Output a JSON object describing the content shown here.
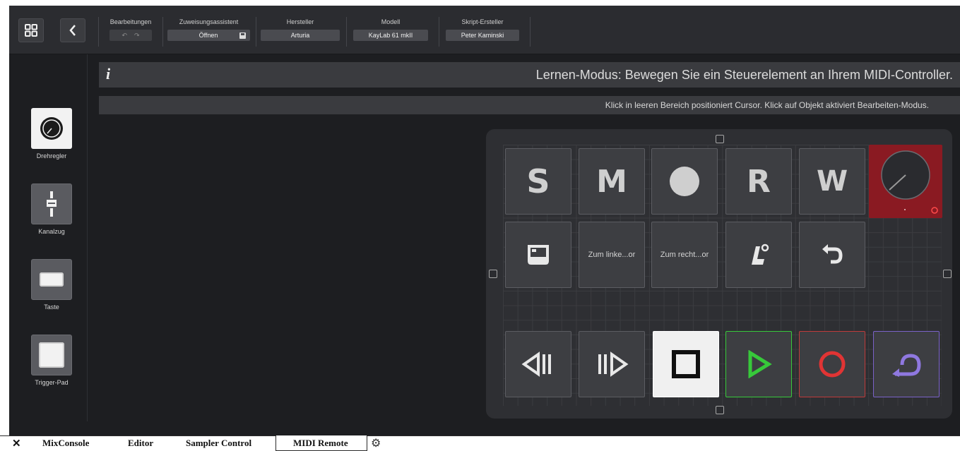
{
  "toolbar": {
    "layout_icon": "grid-icon",
    "back_icon": "chevron-left-icon",
    "edits": {
      "label": "Bearbeitungen",
      "undo_icon": "undo-icon",
      "redo_icon": "redo-icon"
    },
    "assignment": {
      "label": "Zuweisungsassistent",
      "button": "Öffnen",
      "icon": "save-icon"
    },
    "manufacturer": {
      "label": "Hersteller",
      "value": "Arturia"
    },
    "model": {
      "label": "Modell",
      "value": "KayLab 61 mkII"
    },
    "script_author": {
      "label": "Skript-Ersteller",
      "value": "Peter Kaminski"
    }
  },
  "palette": {
    "items": [
      {
        "label": "Drehregler",
        "icon": "knob-icon"
      },
      {
        "label": "Kanalzug",
        "icon": "fader-icon"
      },
      {
        "label": "Taste",
        "icon": "button-icon"
      },
      {
        "label": "Trigger-Pad",
        "icon": "pad-icon"
      }
    ]
  },
  "info": {
    "icon": "i",
    "message": "Lernen-Modus: Bewegen Sie ein Steuerelement an Ihrem MIDI-Controller.",
    "hint": "Klick in leeren Bereich positioniert Cursor. Klick auf Objekt aktiviert Bearbeiten-Modus."
  },
  "surface": {
    "row1": [
      {
        "glyph": "S",
        "name": "solo"
      },
      {
        "glyph": "M",
        "name": "mute"
      },
      {
        "glyph": "●",
        "name": "record-arm"
      },
      {
        "glyph": "R",
        "name": "read"
      },
      {
        "glyph": "W",
        "name": "write"
      }
    ],
    "row2": [
      {
        "name": "window-icon"
      },
      {
        "text": "Zum linke...or",
        "name": "to-left-locator"
      },
      {
        "text": "Zum recht...or",
        "name": "to-right-locator"
      },
      {
        "name": "metronome-icon"
      },
      {
        "name": "undo-icon"
      }
    ],
    "transport": [
      "rewind-icon",
      "forward-icon",
      "stop-icon",
      "play-icon",
      "record-icon",
      "cycle-icon"
    ]
  },
  "colors": {
    "accent_red": "#8a1a22",
    "play_green": "#37c93a",
    "record_red": "#e03434",
    "cycle_purple": "#8f78e0"
  },
  "tabs": [
    {
      "label": "MixConsole"
    },
    {
      "label": "Editor"
    },
    {
      "label": "Sampler Control"
    },
    {
      "label": "MIDI Remote",
      "active": true
    }
  ],
  "tabbar": {
    "close_icon": "close-icon",
    "settings_icon": "gear-icon"
  }
}
